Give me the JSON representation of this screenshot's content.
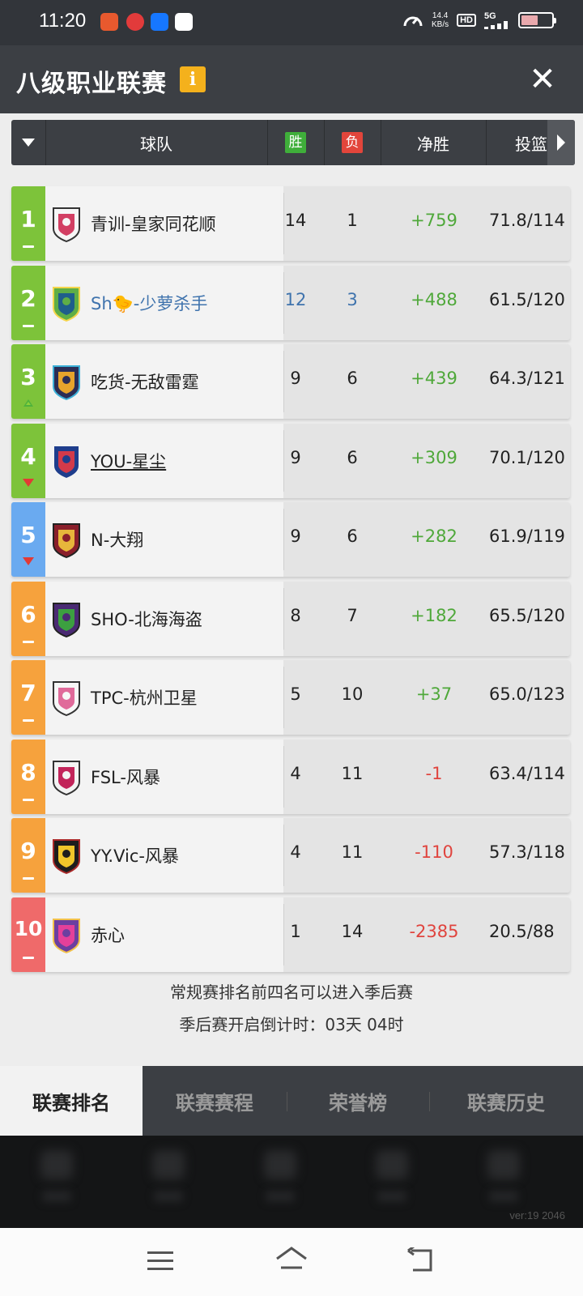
{
  "status_bar": {
    "time": "11:20",
    "speed_value": "14.4",
    "speed_unit": "KB/s",
    "hd_label": "HD",
    "network": "5G",
    "battery_level": 0.55,
    "app_icons": [
      "shopping-app-icon",
      "weibo-app-icon",
      "alipay-app-icon",
      "message-app-icon"
    ]
  },
  "header": {
    "title": "八级职业联赛",
    "info_label": "i",
    "close_label": "✕"
  },
  "columns": {
    "team": "球队",
    "wins": "胜",
    "losses": "负",
    "net": "净胜",
    "shooting": "投篮"
  },
  "colors": {
    "green_band": "#7dc33a",
    "blue_band": "#6aaaf0",
    "orange_band": "#f6a23d",
    "red_band": "#ef6a6a",
    "positive": "#4fa83a",
    "negative": "#e0443e",
    "highlight": "#3f73ad",
    "wins_badge": "#3fae3a",
    "losses_badge": "#e2453b"
  },
  "teams": [
    {
      "rank": "1",
      "trend": "same",
      "band": "green",
      "name": "青训-皇家同花顺",
      "wins": "14",
      "losses": "1",
      "net": "+759",
      "shooting": "71.8/114",
      "logo": "royal-flush-logo-icon"
    },
    {
      "rank": "2",
      "trend": "same",
      "band": "green",
      "name": "Sh🐤-少萝杀手",
      "wins": "12",
      "losses": "3",
      "net": "+488",
      "shooting": "61.5/120",
      "logo": "green-dragon-logo-icon",
      "highlight": true
    },
    {
      "rank": "3",
      "trend": "up",
      "band": "green",
      "name": "吃货-无敌雷霆",
      "wins": "9",
      "losses": "6",
      "net": "+439",
      "shooting": "64.3/121",
      "logo": "thunder-spartan-logo-icon"
    },
    {
      "rank": "4",
      "trend": "down",
      "band": "green",
      "name": "YOU-星尘",
      "wins": "9",
      "losses": "6",
      "net": "+309",
      "shooting": "70.1/120",
      "logo": "bull-logo-icon",
      "underline": true
    },
    {
      "rank": "5",
      "trend": "down",
      "band": "blue",
      "name": "N-大翔",
      "wins": "9",
      "losses": "6",
      "net": "+282",
      "shooting": "61.9/119",
      "logo": "red-warrior-logo-icon"
    },
    {
      "rank": "6",
      "trend": "same",
      "band": "orange",
      "name": "SHO-北海海盗",
      "wins": "8",
      "losses": "7",
      "net": "+182",
      "shooting": "65.5/120",
      "logo": "pirate-logo-icon"
    },
    {
      "rank": "7",
      "trend": "same",
      "band": "orange",
      "name": "TPC-杭州卫星",
      "wins": "5",
      "losses": "10",
      "net": "+37",
      "shooting": "65.0/123",
      "logo": "pink-horse-logo-icon"
    },
    {
      "rank": "8",
      "trend": "same",
      "band": "orange",
      "name": "FSL-风暴",
      "wins": "4",
      "losses": "11",
      "net": "-1",
      "shooting": "63.4/114",
      "logo": "storm-horse-logo-icon"
    },
    {
      "rank": "9",
      "trend": "same",
      "band": "orange",
      "name": "YY.Vic-风暴",
      "wins": "4",
      "losses": "11",
      "net": "-110",
      "shooting": "57.3/118",
      "logo": "golden-wolf-logo-icon"
    },
    {
      "rank": "10",
      "trend": "same",
      "band": "red",
      "name": "赤心",
      "wins": "1",
      "losses": "14",
      "net": "-2385",
      "shooting": "20.5/88",
      "logo": "purple-knight-logo-icon"
    }
  ],
  "notes": {
    "playoff_rule": "常规赛排名前四名可以进入季后赛",
    "countdown": "季后赛开启倒计时：03天 04时"
  },
  "tabs": [
    "联赛排名",
    "联赛赛程",
    "荣誉榜",
    "联赛历史"
  ],
  "active_tab": 0,
  "version": "ver:19  2046"
}
